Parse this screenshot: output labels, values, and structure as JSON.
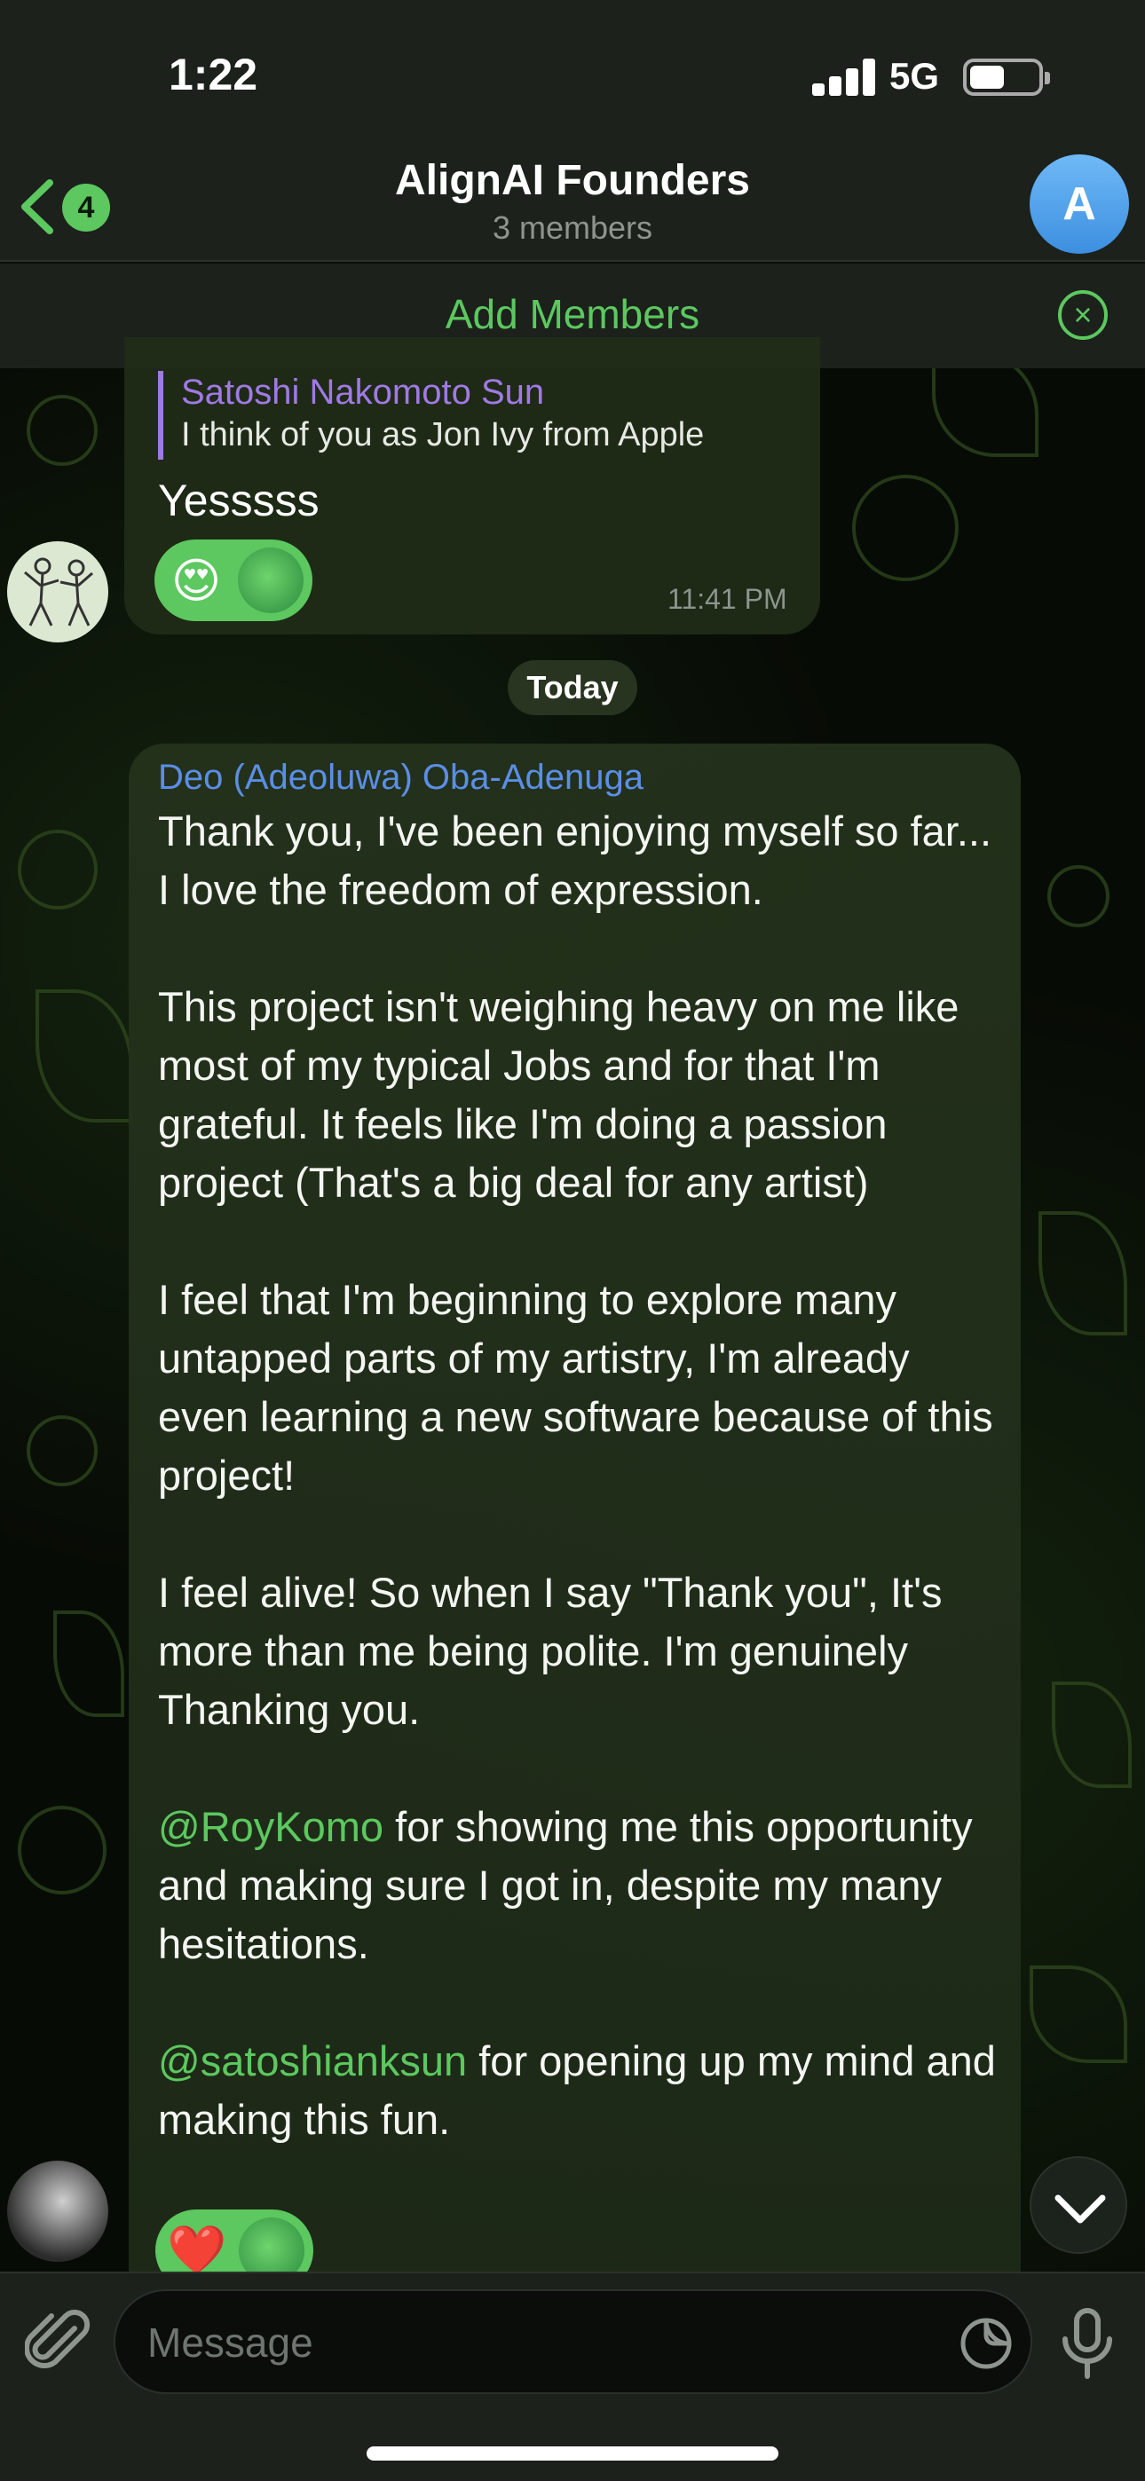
{
  "status_bar": {
    "time": "1:22",
    "network": "5G"
  },
  "header": {
    "back_badge": "4",
    "title": "AlignAI Founders",
    "subtitle": "3 members",
    "avatar_letter": "A"
  },
  "add_members": {
    "label": "Add Members"
  },
  "messages": [
    {
      "reply_name": "Satoshi Nakomoto Sun",
      "reply_text": "I think of you as Jon Ivy from Apple",
      "text": "Yesssss",
      "reactions": [
        "😍",
        "pepe"
      ],
      "time": "11:41 PM"
    },
    {
      "sender": "Deo (Adeoluwa) Oba-Adenuga",
      "paragraphs": [
        "Thank you, I've been enjoying myself so far... I love the freedom of expression.",
        "This project isn't weighing heavy on me like most of my typical Jobs and for that I'm grateful. It feels like I'm doing a passion project (That's a big deal for any artist)",
        "I feel that I'm beginning to explore many untapped parts of my artistry, I'm already even learning a new software because of this project!",
        "I feel alive! So when I say \"Thank you\", It's more than me being polite. I'm genuinely Thanking you."
      ],
      "mention1": "@RoyKomo",
      "mention1_text": " for showing me this opportunity and making sure I got in, despite my many hesitations.",
      "mention2": "@satoshianksun",
      "mention2_text": " for opening up my mind and making this fun.",
      "reactions": [
        "❤️",
        "pepe"
      ]
    }
  ],
  "date_divider": "Today",
  "input": {
    "placeholder": "Message"
  },
  "colors": {
    "accent": "#5cc85f",
    "reply_name": "#a07ae3",
    "sender_name": "#5b8ee6"
  }
}
